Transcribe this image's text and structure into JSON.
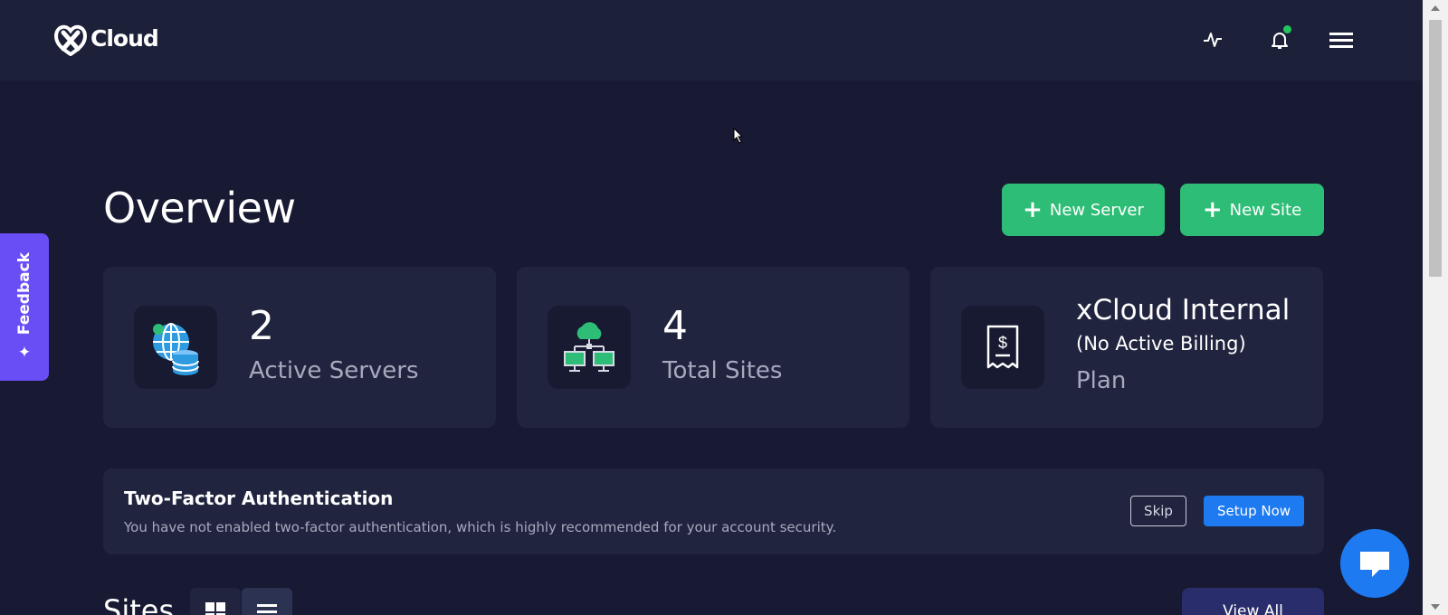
{
  "header": {
    "logo_text": "Cloud"
  },
  "feedback": {
    "label": "Feedback"
  },
  "overview": {
    "title": "Overview",
    "new_server_label": "New Server",
    "new_site_label": "New Site"
  },
  "stats": {
    "servers": {
      "value": "2",
      "label": "Active Servers"
    },
    "sites": {
      "value": "4",
      "label": "Total Sites"
    },
    "plan": {
      "name": "xCloud Internal",
      "sub": "(No Active Billing)",
      "label": "Plan"
    }
  },
  "two_factor": {
    "title": "Two-Factor Authentication",
    "description": "You have not enabled two-factor authentication, which is highly recommended for your account security.",
    "skip_label": "Skip",
    "setup_label": "Setup Now"
  },
  "sites_section": {
    "title": "Sites",
    "view_all_label": "View All"
  },
  "colors": {
    "background": "#181a33",
    "card": "#21243f",
    "accent_green": "#2ebd76",
    "accent_blue": "#1d7af0",
    "feedback_purple": "#6a4ef5"
  },
  "icons": {
    "logo": "xcloud-logo-icon",
    "activity": "activity-icon",
    "notifications": "bell-icon",
    "menu": "hamburger-menu-icon",
    "servers_card": "globe-database-icon",
    "sites_card": "cloud-network-icon",
    "plan_card": "receipt-dollar-icon",
    "chat": "chat-icon"
  }
}
